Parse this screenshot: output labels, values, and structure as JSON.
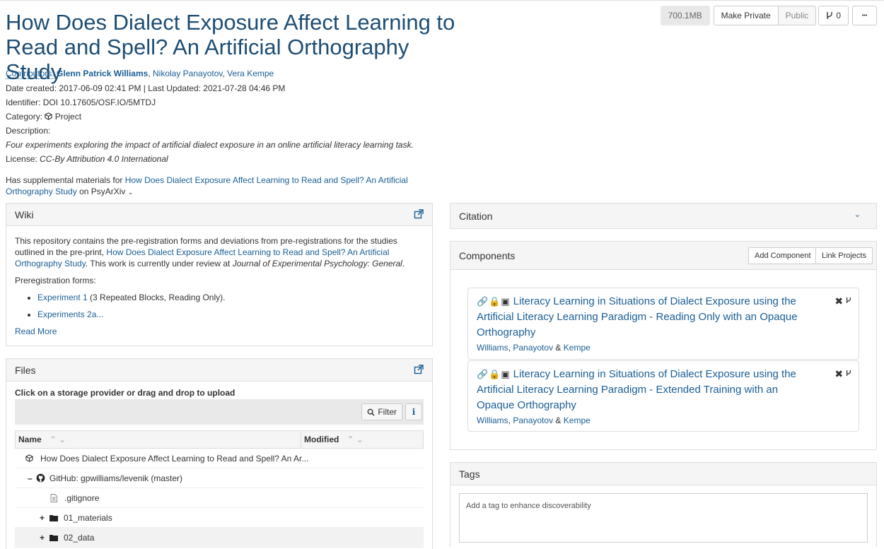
{
  "project": {
    "title": "How Does Dialect Exposure Affect Learning to Read and Spell? An Artificial Orthography Study",
    "contributors_label": "Contributors:",
    "contributors": [
      "Glenn Patrick Williams",
      "Nikolay Panayotov",
      "Vera Kempe"
    ],
    "date_line": "Date created: 2017-06-09 02:41 PM | Last Updated: 2021-07-28 04:46 PM",
    "identifier_line": "Identifier: DOI 10.17605/OSF.IO/5MTDJ",
    "category_label": "Category:",
    "category_value": "Project",
    "description_label": "Description:",
    "description": "Four experiments exploring the impact of artificial dialect exposure in an online artificial literacy learning task.",
    "license_label": "License:",
    "license_value": "CC-By Attribution 4.0 International",
    "supplemental_prefix": "Has supplemental materials for",
    "supplemental_link": "How Does Dialect Exposure Affect Learning to Read and Spell? An Artificial Orthography Study",
    "supplemental_suffix": "on PsyArXiv"
  },
  "toolbar": {
    "size": "700.1MB",
    "make_private": "Make Private",
    "public": "Public",
    "fork_count": "0",
    "more": "•••"
  },
  "wiki": {
    "heading": "Wiki",
    "p1_before": "This repository contains the pre-registration forms and deviations from pre-registrations for the studies outlined in the pre-print,",
    "p1_link": "How Does Dialect Exposure Affect Learning to Read and Spell? An Artificial Orthography Study",
    "p1_mid": ". This work is currently under review at",
    "p1_journal": "Journal of Experimental Psychology: General",
    "p1_end": ".",
    "prereg_label": "Preregistration forms:",
    "items": [
      {
        "link": "Experiment 1",
        "text": "(3 Repeated Blocks, Reading Only)."
      },
      {
        "link": "Experiments 2a...",
        "text": ""
      }
    ],
    "read_more": "Read More"
  },
  "files": {
    "heading": "Files",
    "instruction": "Click on a storage provider or drag and drop to upload",
    "filter_label": "Filter",
    "info_label": "i",
    "col_name": "Name",
    "col_modified": "Modified",
    "rows": [
      {
        "name": "How Does Dialect Exposure Affect Learning to Read and Spell? An Ar...",
        "toggle": ""
      },
      {
        "name": "GitHub: gpwilliams/levenik (master)",
        "toggle": "–"
      },
      {
        "name": ".gitignore",
        "toggle": ""
      },
      {
        "name": "01_materials",
        "toggle": "+"
      },
      {
        "name": "02_data",
        "toggle": "+"
      }
    ]
  },
  "citation": {
    "heading": "Citation"
  },
  "components": {
    "heading": "Components",
    "add_label": "Add Component",
    "link_label": "Link Projects",
    "items": [
      {
        "title": "Literacy Learning in Situations of Dialect Exposure using the Artificial Literacy Learning Paradigm - Reading Only with an Opaque Orthography",
        "authors": [
          "Williams",
          "Panayotov",
          "Kempe"
        ],
        "sep1": ",",
        "sep2": "&"
      },
      {
        "title": "Literacy Learning in Situations of Dialect Exposure using the Artificial Literacy Learning Paradigm - Extended Training with an Opaque Orthography",
        "authors": [
          "Williams",
          "Panayotov",
          "Kempe"
        ],
        "sep1": ",",
        "sep2": "&"
      }
    ]
  },
  "tags": {
    "heading": "Tags",
    "placeholder": "Add a tag to enhance discoverability"
  }
}
